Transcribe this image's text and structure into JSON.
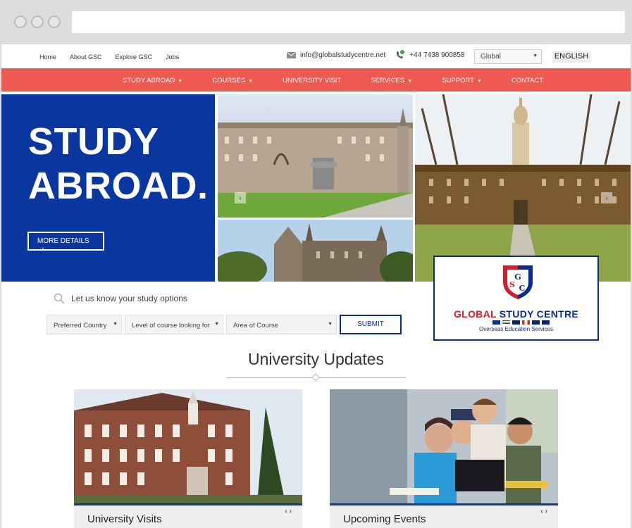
{
  "topbar": {
    "links": [
      "Home",
      "About GSC",
      "Explore GSC",
      "Jobs"
    ],
    "email": "info@globalstudycentre.net",
    "phone": "+44 7438 900858",
    "region_select": "Global",
    "language": "ENGLISH"
  },
  "nav": {
    "items": [
      {
        "label": "STUDY ABROAD",
        "dropdown": true
      },
      {
        "label": "COURSES",
        "dropdown": true
      },
      {
        "label": "UNIVERSITY VISIT",
        "dropdown": false
      },
      {
        "label": "SERVICES",
        "dropdown": true
      },
      {
        "label": "SUPPORT",
        "dropdown": true
      },
      {
        "label": "CONTACT",
        "dropdown": false
      }
    ],
    "color": "#ee5a50"
  },
  "hero": {
    "title_line1": "STUDY",
    "title_line2": "ABROAD.",
    "button": "MORE DETAILS",
    "color": "#0a36a0"
  },
  "logo": {
    "name_part1": "GLOBAL",
    "name_part2": "STUDY CENTRE",
    "subtitle": "Overseas Education Services",
    "monogram": "GSC"
  },
  "study_options": {
    "prompt": "Let us know your study options",
    "filters": [
      "Preferred Country",
      "Level of course looking for",
      "Area of Course"
    ],
    "submit": "SUBMIT"
  },
  "updates": {
    "title": "University Updates",
    "cards": [
      {
        "label": "University Visits"
      },
      {
        "label": "Upcoming Events"
      }
    ]
  }
}
